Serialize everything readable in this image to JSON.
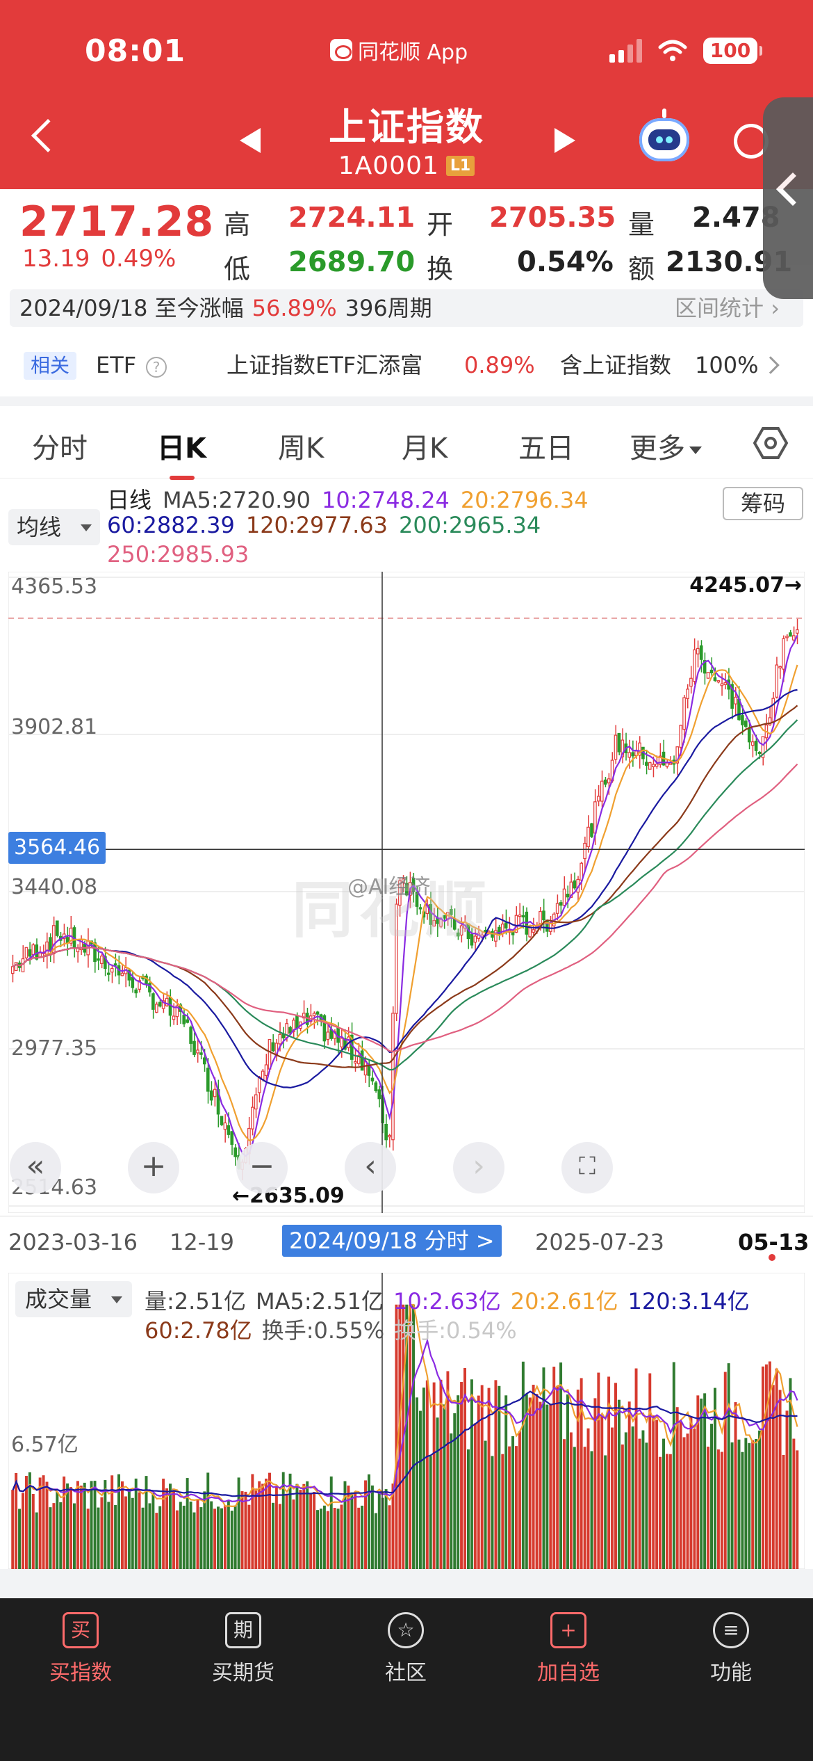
{
  "status_bar": {
    "time": "08:01",
    "app_name": "同花顺 App",
    "battery": "100"
  },
  "header": {
    "title": "上证指数",
    "code": "1A0001",
    "level": "L1"
  },
  "quote": {
    "price": "2717.28",
    "change": "13.19",
    "change_pct": "0.49%",
    "high_label": "高",
    "high": "2724.11",
    "low_label": "低",
    "low": "2689.70",
    "open_label": "开",
    "open": "2705.35",
    "turnover_label": "换",
    "turnover": "0.54%",
    "volume_label": "量",
    "volume": "2.478",
    "amount_label": "额",
    "amount": "2130.91"
  },
  "period": {
    "start": "2024/09/18 至今涨幅",
    "pct": "56.89%",
    "cycles": "396周期",
    "stats": "区间统计"
  },
  "related": {
    "badge": "相关",
    "etf": "ETF",
    "help": "?",
    "etf_name": "上证指数ETF汇添富",
    "etf_change": "0.89%",
    "contains": "含上证指数",
    "contains_pct": "100%"
  },
  "tabs": [
    "分时",
    "日K",
    "周K",
    "月K",
    "五日",
    "更多"
  ],
  "ma_legend": {
    "selector": "均线",
    "period": "日线",
    "ma5": "MA5:2720.90",
    "ma10": "10:2748.24",
    "ma20": "20:2796.34",
    "ma60": "60:2882.39",
    "ma120": "120:2977.63",
    "ma200": "200:2965.34",
    "ma250": "250:2985.93",
    "chip_button": "筹码"
  },
  "kchart": {
    "y_ticks": [
      "4365.53",
      "3902.81",
      "3440.08",
      "2977.35",
      "2514.63"
    ],
    "crosshair": "3564.46",
    "max_label": "4245.07→",
    "min_label": "←2635.09",
    "watermark": "同花顺",
    "weibo": "@AI经济"
  },
  "date_axis": {
    "d1": "2023-03-16",
    "d2": "12-19",
    "highlight": "2024/09/18 分时 >",
    "d4": "2025-07-23",
    "d5": "05-13"
  },
  "vol_legend": {
    "selector": "成交量",
    "vol": "量:2.51亿",
    "ma5": "MA5:2.51亿",
    "ma10": "10:2.63亿",
    "ma20": "20:2.61亿",
    "ma120": "120:3.14亿",
    "ma60": "60:2.78亿",
    "turnover": "换手:0.55%",
    "turnover2": "换手:0.54%",
    "y_tick": "6.57亿"
  },
  "bottom_nav": [
    {
      "icon": "买",
      "label": "买指数"
    },
    {
      "icon": "期",
      "label": "买期货"
    },
    {
      "icon": "☆",
      "label": "社区"
    },
    {
      "icon": "+",
      "label": "加自选"
    },
    {
      "icon": "≡",
      "label": "功能"
    }
  ],
  "colors": {
    "header_red": "#e23b3b",
    "up": "#e23b3b",
    "down": "#2a9a2a",
    "ma5": "#e0a020",
    "ma10": "#8a2be2",
    "ma20": "#f0a030",
    "ma60": "#1a1aa0",
    "ma120": "#8b3a1a",
    "ma200": "#2a8a5a",
    "ma250": "#e06080"
  },
  "chart_data": {
    "type": "candlestick",
    "y_ticks": [
      4365.53,
      3902.81,
      3440.08,
      2977.35,
      2514.63
    ],
    "ylim": [
      2514.63,
      4365.53
    ],
    "x_labels": [
      "2023-03-16",
      "12-19",
      "2024/09/18",
      "2025-07-23",
      "05-13"
    ],
    "max": 4245.07,
    "min": 2635.09,
    "crosshair_value": 3564.46,
    "series": [
      {
        "name": "close",
        "x": [
          "2023-03-16",
          "12-19",
          "2024/09/18",
          "2025-07-23",
          "05-13"
        ],
        "values": [
          3240,
          3100,
          2720,
          3560,
          4245.07
        ]
      }
    ]
  }
}
